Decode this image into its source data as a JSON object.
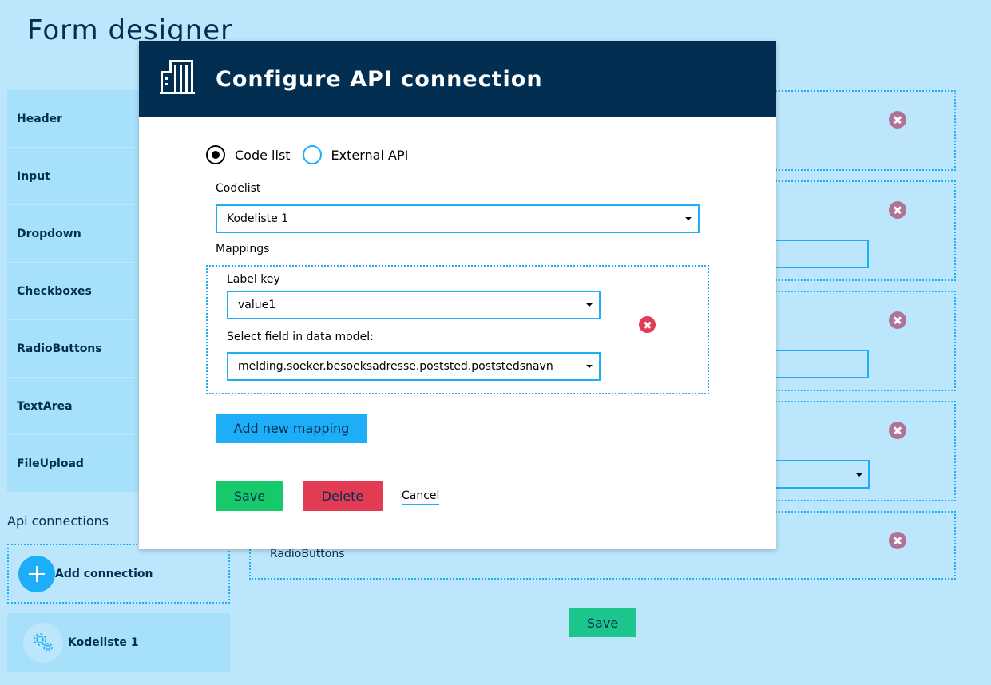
{
  "page": {
    "title": "Form designer"
  },
  "toolbar": {
    "items": [
      {
        "label": "Header"
      },
      {
        "label": "Input"
      },
      {
        "label": "Dropdown"
      },
      {
        "label": "Checkboxes"
      },
      {
        "label": "RadioButtons"
      },
      {
        "label": "TextArea"
      },
      {
        "label": "FileUpload"
      }
    ]
  },
  "api_connections": {
    "heading": "Api connections",
    "add_label": "Add connection",
    "items": [
      {
        "label": "Kodeliste 1",
        "icon": "gears-icon"
      }
    ]
  },
  "canvas": {
    "last_field_label": "RadioButtons",
    "save_label": "Save"
  },
  "modal": {
    "title": "Configure API connection",
    "icon": "building-icon",
    "radio_options": [
      {
        "label": "Code list",
        "checked": true
      },
      {
        "label": "External API",
        "checked": false
      }
    ],
    "codelist_label": "Codelist",
    "codelist_value": "Kodeliste 1",
    "mappings_label": "Mappings",
    "mapping": {
      "label_key_label": "Label key",
      "label_key_value": "value1",
      "field_label": "Select field in data model:",
      "field_value": "melding.soeker.besoeksadresse.poststed.poststedsnavn"
    },
    "add_mapping_label": "Add new mapping",
    "save_label": "Save",
    "delete_label": "Delete",
    "cancel_label": "Cancel"
  },
  "colors": {
    "background": "#bbe6fb",
    "primary": "#1eaef7",
    "header": "#022f51",
    "success": "#17c96b",
    "danger": "#e23b53"
  }
}
